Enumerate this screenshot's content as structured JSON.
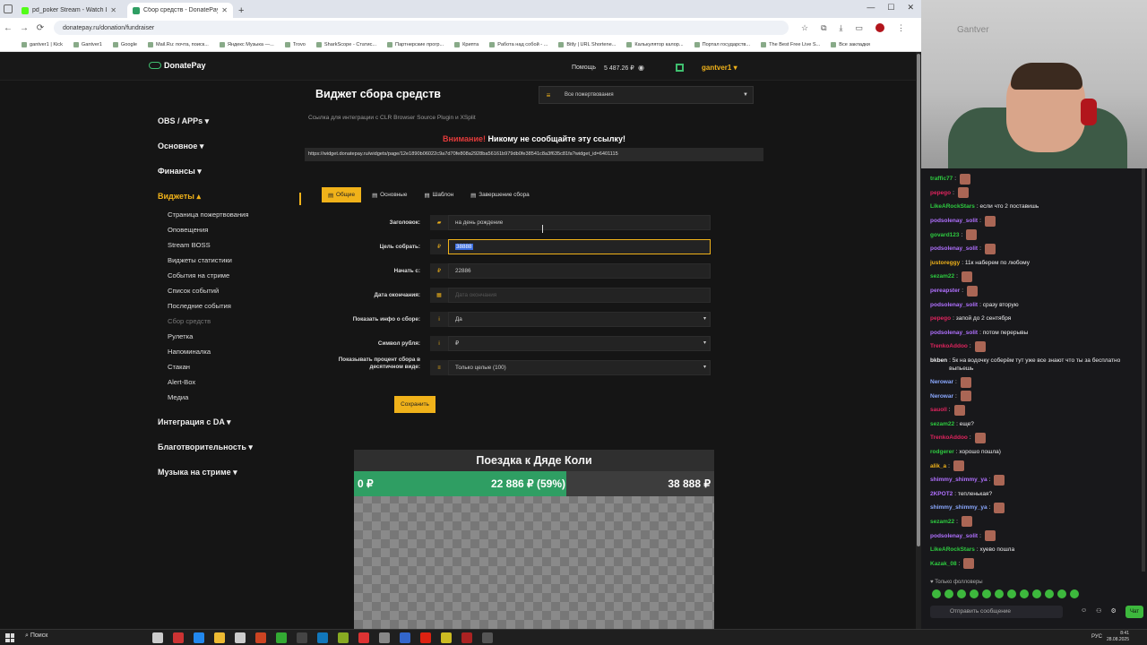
{
  "browser": {
    "tabs": [
      {
        "title": "pd_poker Stream - Watch Live",
        "active": false,
        "color": "#53fc18"
      },
      {
        "title": "Сбор средств - DonatePay.ru",
        "active": true,
        "color": "#2f9e63"
      }
    ],
    "url": "donatepay.ru/donation/fundraiser",
    "bookmarks": [
      "gantver1 | Kick",
      "Gantver1",
      "Google",
      "Mail.Ru: почта, поиск...",
      "Яндекс Музыка —...",
      "Trovo",
      "SharkScope - Статис...",
      "Партнерские прогр...",
      "Крипта",
      "Работа над собой - ...",
      "Bitly | URL Shortene...",
      "Калькулятор калор...",
      "Портал государств...",
      "The Best Free Live S...",
      "Все закладки"
    ]
  },
  "header": {
    "logo": "DonatePay",
    "help": "Помощь",
    "balance": "5 487.26 ₽",
    "user": "gantver1 ▾"
  },
  "sidebar": {
    "sections": [
      {
        "label": "OBS / APPs ▾",
        "active": false
      },
      {
        "label": "Основное ▾",
        "active": false
      },
      {
        "label": "Финансы ▾",
        "active": false
      },
      {
        "label": "Виджеты ▴",
        "active": true
      },
      {
        "label": "Интеграция с DA ▾",
        "active": false
      },
      {
        "label": "Благотворительность ▾",
        "active": false
      },
      {
        "label": "Музыка на стриме ▾",
        "active": false
      }
    ],
    "widget_items": [
      "Страница пожертвования",
      "Оповещения",
      "Stream BOSS",
      "Виджеты статистики",
      "События на стриме",
      "Список событий",
      "Последние события",
      "Сбор средств",
      "Рулетка",
      "Напоминалка",
      "Стакан",
      "Alert-Box",
      "Медиа"
    ]
  },
  "main": {
    "title": "Виджет сбора средств",
    "select_value": "Все пожертвования",
    "subtitle": "Ссылка для интеграции с CLR Browser Source Plugin и XSplit",
    "warn_red": "Внимание!",
    "warn_text": " Никому не сообщайте эту ссылку!",
    "link": "https://widget.donatepay.ru/widgets/page/12e1890b06022c9a7d70fe808a2928ba56161b979db0fe38541c8a3f635c81fa?widget_id=6401115",
    "tabs": [
      "Общие",
      "Основные",
      "Шаблон",
      "Завершение сбора"
    ],
    "fields": {
      "title_label": "Заголовок:",
      "title_value": "на день рождение",
      "goal_label": "Цель собрать:",
      "goal_value": "38888",
      "start_label": "Начать с:",
      "start_value": "22886",
      "end_label": "Дата окончания:",
      "end_placeholder": "Дата окончания",
      "info_label": "Показать инфо о сборе:",
      "info_value": "Да",
      "symbol_label": "Символ рубля:",
      "symbol_value": "₽",
      "percent_label": "Показывать процент сбора в десятичном виде:",
      "percent_value": "Только целые (100)"
    },
    "save": "Сохранить",
    "preview": {
      "title": "Поездка к Дяде Коли",
      "start": "0 ₽",
      "current": "22 886 ₽ (59%)",
      "goal": "38 888 ₽",
      "progress": 0.59
    }
  },
  "chat": {
    "messages": [
      {
        "user": "traffic77",
        "text": ":",
        "color": "#2ecc40"
      },
      {
        "user": "pepego",
        "text": ":",
        "color": "#e0245e"
      },
      {
        "user": "LikeARockStars",
        "text": ": если что 2 поставишь",
        "color": "#2ecc40"
      },
      {
        "user": "podsolenay_solit",
        "text": ":",
        "color": "#b070ff"
      },
      {
        "user": "govard123",
        "text": ":",
        "color": "#2ecc40"
      },
      {
        "user": "podsolenay_solit",
        "text": ":",
        "color": "#b070ff"
      },
      {
        "user": "justoreggy",
        "text": ": 11к наберем по любому",
        "color": "#f0b21a"
      },
      {
        "user": "sezam22",
        "text": ":",
        "color": "#2ecc40"
      },
      {
        "user": "pereapster",
        "text": ":",
        "color": "#b070ff"
      },
      {
        "user": "podsolenay_solit",
        "text": ": сразу вторую",
        "color": "#b070ff"
      },
      {
        "user": "pepego",
        "text": ": запой до 2 сентября",
        "color": "#e0245e"
      },
      {
        "user": "podsolenay_solit",
        "text": ": потом перерывы",
        "color": "#b070ff"
      },
      {
        "user": "TrenkoAddoo",
        "text": ":",
        "color": "#e0245e"
      },
      {
        "user": "bkben",
        "text": ": 5к на водочку соберём тут уже все знают что ты за бесплатно выпьешь",
        "color": "#efeff1"
      },
      {
        "user": "Nerowar",
        "text": ":",
        "color": "#8aa8ff"
      },
      {
        "user": "Nerowar",
        "text": ":",
        "color": "#8aa8ff"
      },
      {
        "user": "sauoll",
        "text": ":",
        "color": "#e0245e"
      },
      {
        "user": "sezam22",
        "text": ": еще?",
        "color": "#2ecc40"
      },
      {
        "user": "TrenkoAddoo",
        "text": ":",
        "color": "#e0245e"
      },
      {
        "user": "rodgerer",
        "text": ": хорошо пошла)",
        "color": "#2ecc40"
      },
      {
        "user": "alik_a",
        "text": ":",
        "color": "#f0b21a"
      },
      {
        "user": "shimmy_shimmy_ya",
        "text": ":",
        "color": "#b070ff"
      },
      {
        "user": "2KPOT2",
        "text": ": тепленькая?",
        "color": "#b070ff"
      },
      {
        "user": "shimmy_shimmy_ya",
        "text": ":",
        "color": "#8aa8ff"
      },
      {
        "user": "sezam22",
        "text": ":",
        "color": "#2ecc40"
      },
      {
        "user": "podsolenay_solit",
        "text": ":",
        "color": "#b070ff"
      },
      {
        "user": "LikeARockStars",
        "text": ": хуево пошла",
        "color": "#2ecc40"
      },
      {
        "user": "Kazak_08",
        "text": ":",
        "color": "#2ecc40"
      }
    ],
    "followers_only": "Только фолловеры",
    "input_placeholder": "Отправить сообщение",
    "send": "Чат"
  },
  "taskbar": {
    "search": "Поиск",
    "lang": "РУС",
    "time": "8:41",
    "date": "28.08.2025"
  }
}
